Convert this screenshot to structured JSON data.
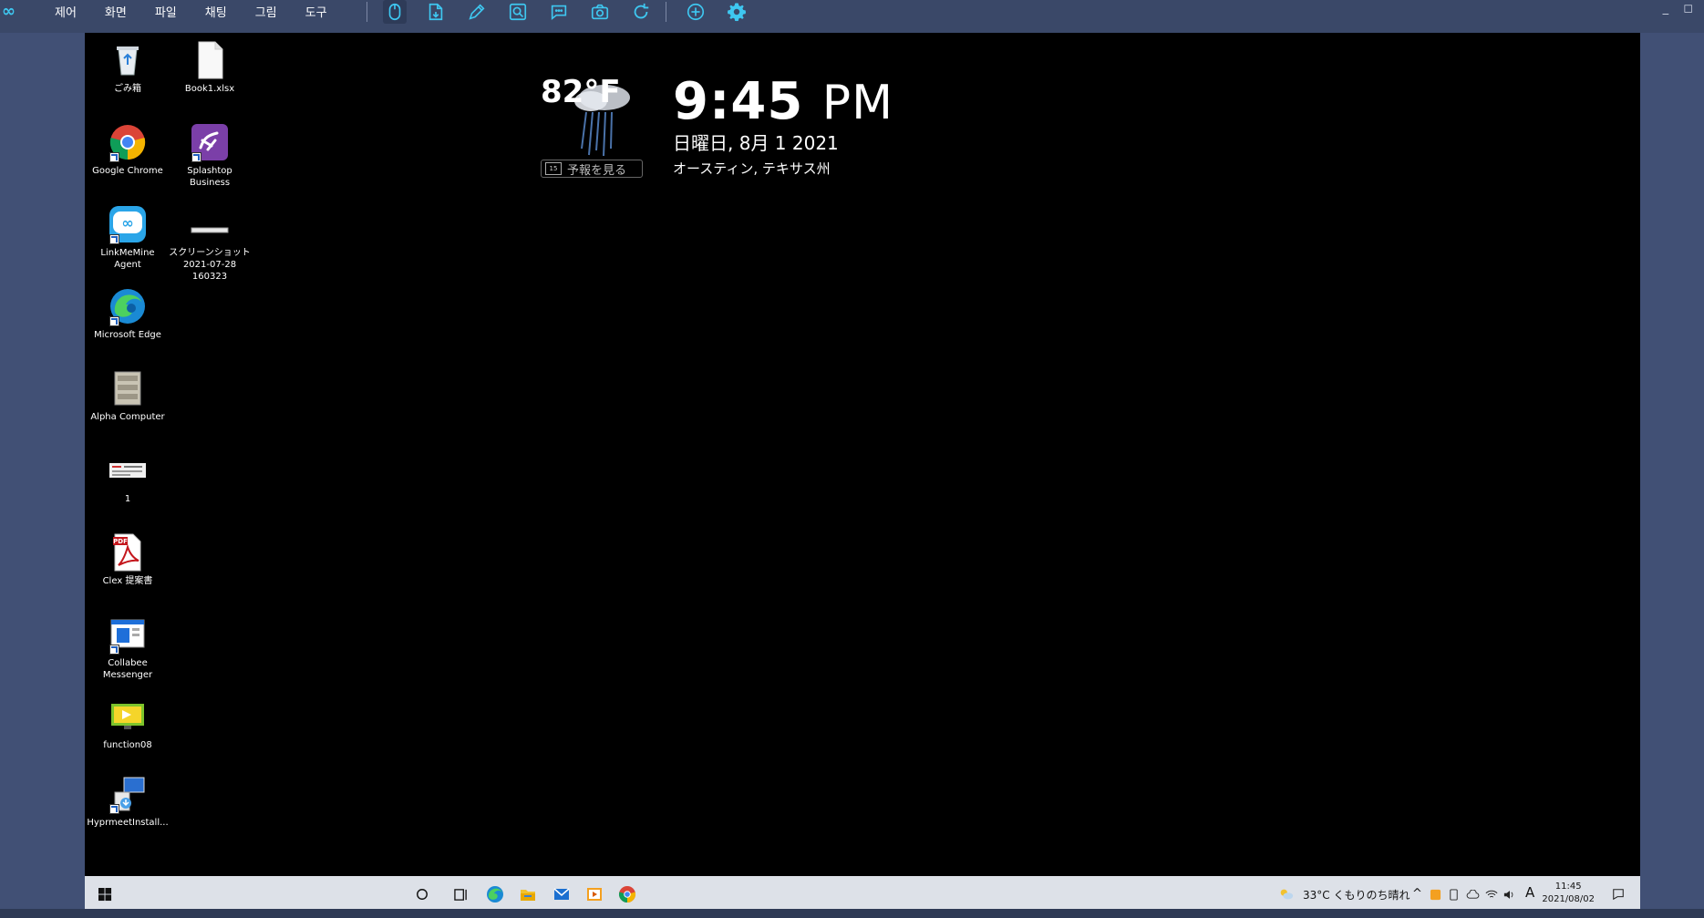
{
  "toolbar": {
    "logo": "∞",
    "menus": [
      "제어",
      "화면",
      "파일",
      "채팅",
      "그림",
      "도구"
    ],
    "tools": [
      "mouse-icon",
      "file-transfer-icon",
      "pen-icon",
      "image-search-icon",
      "chat-icon",
      "camera-icon",
      "refresh-icon",
      "add-circle-icon",
      "gear-icon"
    ],
    "accent": "#3ec7f0",
    "window_controls": "_ ◻"
  },
  "desktop": {
    "icons": [
      {
        "label": "ごみ箱",
        "icon": "recycle-bin-icon"
      },
      {
        "label": "Book1.xlsx",
        "icon": "document-icon"
      },
      {
        "label": "Google Chrome",
        "icon": "chrome-icon"
      },
      {
        "label": "Splashtop Business",
        "icon": "splashtop-icon"
      },
      {
        "label": "LinkMeMine Agent",
        "icon": "linkmemine-icon"
      },
      {
        "label": "スクリーンショット 2021-07-28 160323",
        "icon": "screenshot-file-icon"
      },
      {
        "label": "Microsoft Edge",
        "icon": "edge-icon"
      },
      {
        "label": "Alpha Computer",
        "icon": "alpha-computer-icon"
      },
      {
        "label": "1",
        "icon": "image-file-icon"
      },
      {
        "label": "Clex 提案書",
        "icon": "pdf-icon"
      },
      {
        "label": "Collabee Messenger",
        "icon": "collabee-icon"
      },
      {
        "label": "function08",
        "icon": "video-icon"
      },
      {
        "label": "HyprmeetInstall...",
        "icon": "installer-icon"
      }
    ]
  },
  "widget": {
    "temperature": "82°F",
    "forecast_button": "予報を見る",
    "forecast_cal": "15",
    "time": "9:45",
    "ampm": "PM",
    "date": "日曜日, 8月 1 2021",
    "location": "オースティン, テキサス州"
  },
  "taskbar": {
    "weather": "33°C くもりのち晴れ",
    "ime": "A",
    "clock_time": "11:45",
    "clock_date": "2021/08/02"
  }
}
